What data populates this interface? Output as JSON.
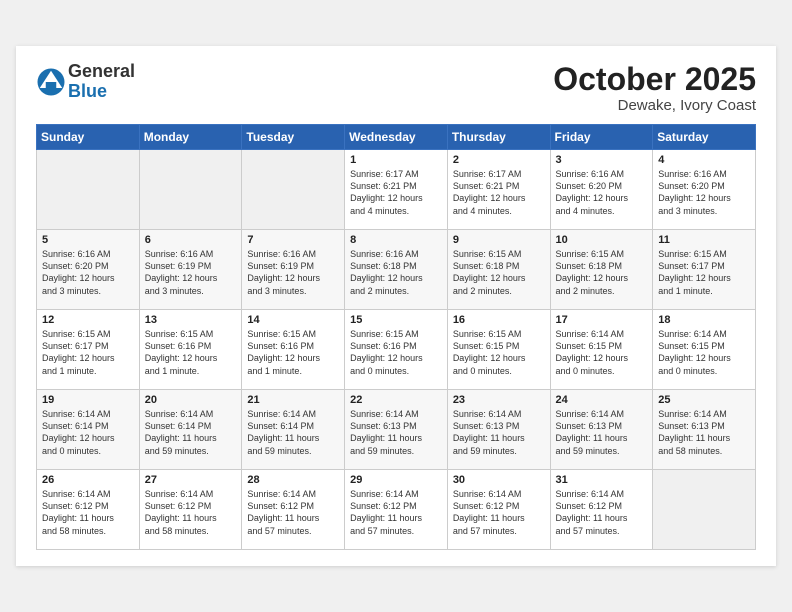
{
  "header": {
    "logo_general": "General",
    "logo_blue": "Blue",
    "month": "October 2025",
    "location": "Dewake, Ivory Coast"
  },
  "weekdays": [
    "Sunday",
    "Monday",
    "Tuesday",
    "Wednesday",
    "Thursday",
    "Friday",
    "Saturday"
  ],
  "weeks": [
    [
      {
        "day": "",
        "info": ""
      },
      {
        "day": "",
        "info": ""
      },
      {
        "day": "",
        "info": ""
      },
      {
        "day": "1",
        "info": "Sunrise: 6:17 AM\nSunset: 6:21 PM\nDaylight: 12 hours\nand 4 minutes."
      },
      {
        "day": "2",
        "info": "Sunrise: 6:17 AM\nSunset: 6:21 PM\nDaylight: 12 hours\nand 4 minutes."
      },
      {
        "day": "3",
        "info": "Sunrise: 6:16 AM\nSunset: 6:20 PM\nDaylight: 12 hours\nand 4 minutes."
      },
      {
        "day": "4",
        "info": "Sunrise: 6:16 AM\nSunset: 6:20 PM\nDaylight: 12 hours\nand 3 minutes."
      }
    ],
    [
      {
        "day": "5",
        "info": "Sunrise: 6:16 AM\nSunset: 6:20 PM\nDaylight: 12 hours\nand 3 minutes."
      },
      {
        "day": "6",
        "info": "Sunrise: 6:16 AM\nSunset: 6:19 PM\nDaylight: 12 hours\nand 3 minutes."
      },
      {
        "day": "7",
        "info": "Sunrise: 6:16 AM\nSunset: 6:19 PM\nDaylight: 12 hours\nand 3 minutes."
      },
      {
        "day": "8",
        "info": "Sunrise: 6:16 AM\nSunset: 6:18 PM\nDaylight: 12 hours\nand 2 minutes."
      },
      {
        "day": "9",
        "info": "Sunrise: 6:15 AM\nSunset: 6:18 PM\nDaylight: 12 hours\nand 2 minutes."
      },
      {
        "day": "10",
        "info": "Sunrise: 6:15 AM\nSunset: 6:18 PM\nDaylight: 12 hours\nand 2 minutes."
      },
      {
        "day": "11",
        "info": "Sunrise: 6:15 AM\nSunset: 6:17 PM\nDaylight: 12 hours\nand 1 minute."
      }
    ],
    [
      {
        "day": "12",
        "info": "Sunrise: 6:15 AM\nSunset: 6:17 PM\nDaylight: 12 hours\nand 1 minute."
      },
      {
        "day": "13",
        "info": "Sunrise: 6:15 AM\nSunset: 6:16 PM\nDaylight: 12 hours\nand 1 minute."
      },
      {
        "day": "14",
        "info": "Sunrise: 6:15 AM\nSunset: 6:16 PM\nDaylight: 12 hours\nand 1 minute."
      },
      {
        "day": "15",
        "info": "Sunrise: 6:15 AM\nSunset: 6:16 PM\nDaylight: 12 hours\nand 0 minutes."
      },
      {
        "day": "16",
        "info": "Sunrise: 6:15 AM\nSunset: 6:15 PM\nDaylight: 12 hours\nand 0 minutes."
      },
      {
        "day": "17",
        "info": "Sunrise: 6:14 AM\nSunset: 6:15 PM\nDaylight: 12 hours\nand 0 minutes."
      },
      {
        "day": "18",
        "info": "Sunrise: 6:14 AM\nSunset: 6:15 PM\nDaylight: 12 hours\nand 0 minutes."
      }
    ],
    [
      {
        "day": "19",
        "info": "Sunrise: 6:14 AM\nSunset: 6:14 PM\nDaylight: 12 hours\nand 0 minutes."
      },
      {
        "day": "20",
        "info": "Sunrise: 6:14 AM\nSunset: 6:14 PM\nDaylight: 11 hours\nand 59 minutes."
      },
      {
        "day": "21",
        "info": "Sunrise: 6:14 AM\nSunset: 6:14 PM\nDaylight: 11 hours\nand 59 minutes."
      },
      {
        "day": "22",
        "info": "Sunrise: 6:14 AM\nSunset: 6:13 PM\nDaylight: 11 hours\nand 59 minutes."
      },
      {
        "day": "23",
        "info": "Sunrise: 6:14 AM\nSunset: 6:13 PM\nDaylight: 11 hours\nand 59 minutes."
      },
      {
        "day": "24",
        "info": "Sunrise: 6:14 AM\nSunset: 6:13 PM\nDaylight: 11 hours\nand 59 minutes."
      },
      {
        "day": "25",
        "info": "Sunrise: 6:14 AM\nSunset: 6:13 PM\nDaylight: 11 hours\nand 58 minutes."
      }
    ],
    [
      {
        "day": "26",
        "info": "Sunrise: 6:14 AM\nSunset: 6:12 PM\nDaylight: 11 hours\nand 58 minutes."
      },
      {
        "day": "27",
        "info": "Sunrise: 6:14 AM\nSunset: 6:12 PM\nDaylight: 11 hours\nand 58 minutes."
      },
      {
        "day": "28",
        "info": "Sunrise: 6:14 AM\nSunset: 6:12 PM\nDaylight: 11 hours\nand 57 minutes."
      },
      {
        "day": "29",
        "info": "Sunrise: 6:14 AM\nSunset: 6:12 PM\nDaylight: 11 hours\nand 57 minutes."
      },
      {
        "day": "30",
        "info": "Sunrise: 6:14 AM\nSunset: 6:12 PM\nDaylight: 11 hours\nand 57 minutes."
      },
      {
        "day": "31",
        "info": "Sunrise: 6:14 AM\nSunset: 6:12 PM\nDaylight: 11 hours\nand 57 minutes."
      },
      {
        "day": "",
        "info": ""
      }
    ]
  ]
}
